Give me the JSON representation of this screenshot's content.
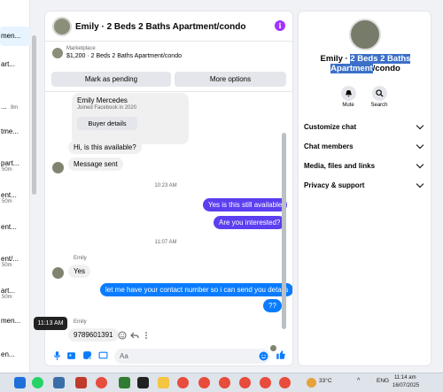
{
  "left_list": [
    {
      "title": "men...",
      "sub": ""
    },
    {
      "title": "art...",
      "sub": ""
    },
    {
      "title": "...",
      "sub": "9m"
    },
    {
      "title": "tme...",
      "sub": ""
    },
    {
      "title": "part...",
      "sub": "50m"
    },
    {
      "title": "ent...",
      "sub": "50m"
    },
    {
      "title": "ent...",
      "sub": ""
    },
    {
      "title": "ent/...",
      "sub": "50m"
    },
    {
      "title": "art...",
      "sub": "50m"
    },
    {
      "title": "men...",
      "sub": ""
    },
    {
      "title": "en...",
      "sub": ""
    }
  ],
  "chat": {
    "title": "Emily · 2 Beds 2 Baths Apartment/condo",
    "marketplace_label": "Marketplace",
    "listing": "$1,200 · 2 Beds 2 Baths Apartment/condo",
    "mark_pending": "Mark as pending",
    "more_options": "More options",
    "card_name": "Emily Mercedes",
    "card_joined": "Joined Facebook in 2020",
    "buyer_details": "Buyer details",
    "msg1": "Hi, is this available?",
    "msg2": "Message sent",
    "ts1": "10:23 AM",
    "out1": "Yes is this still available",
    "out2": "Are you interested?",
    "ts2": "11:07 AM",
    "sender1": "Emily",
    "msg3": "Yes",
    "out3": "let me have your contact number so i can send you details",
    "out4": "??",
    "sender2": "Emily",
    "msg4": "9789601391",
    "tooltip": "11:13 AM",
    "input_placeholder": "Aa"
  },
  "right_panel": {
    "title_part1": "Emily · ",
    "title_hl1": "2 Beds 2 Baths",
    "title_hl2": "Apartment",
    "title_part2": "/condo",
    "mute": "Mute",
    "search": "Search",
    "sections": [
      "Customize chat",
      "Chat members",
      "Media, files and links",
      "Privacy & support"
    ]
  },
  "taskbar": {
    "temp": "33°C",
    "lang": "ENG",
    "time": "11:14 am",
    "date": "16/07/2025"
  },
  "colors": {
    "accent": "#5b3ff0",
    "blue": "#0a7cff",
    "info": "#a033ff"
  }
}
